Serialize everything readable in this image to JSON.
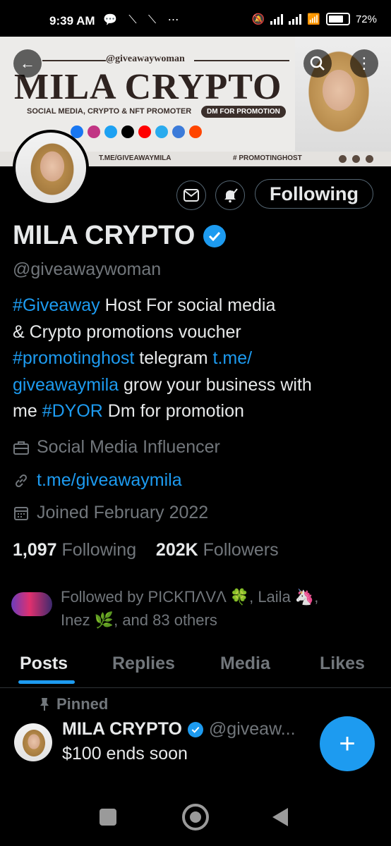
{
  "status_bar": {
    "time": "9:39 AM",
    "left_icons": "💬 ⟍ ⟍ ⋯",
    "battery": "72%"
  },
  "banner": {
    "handle": "@giveawaywoman",
    "title": "MILA CRYPTO",
    "subtitle": "SOCIAL MEDIA, CRYPTO & NFT PROMOTER",
    "dm_badge": "DM FOR PROMOTION",
    "telegram": "T.ME/GIVEAWAYMILA",
    "hashtag": "# PROMOTINGHOST",
    "social_colors": [
      "#1877f2",
      "#c13584",
      "#1da1f2",
      "#000000",
      "#ff0000",
      "#2aabee",
      "#3c7bd9",
      "#ff4500"
    ]
  },
  "header_buttons": {
    "back_icon": "←",
    "search_icon": "⌕",
    "more_icon": "⋮"
  },
  "profile": {
    "name": "MILA CRYPTO",
    "handle": "@giveawaywoman",
    "follow_label": "Following",
    "bio": {
      "tag1": "#Giveaway",
      "t1": " Host For social media",
      "t2": "& Crypto promotions voucher",
      "tag2": "#promotinghost",
      "t3": " telegram ",
      "link1": "t.me/",
      "link2": "giveawaymila",
      "t4": " grow your business with",
      "t5": "me ",
      "tag3": "#DYOR",
      "t6": " Dm for promotion"
    },
    "category": "Social Media Influencer",
    "website": "t.me/giveawaymila",
    "joined": "Joined February 2022",
    "following_count": "1,097",
    "following_label": "Following",
    "followers_count": "202K",
    "followers_label": "Followers",
    "followed_by_line1": "Followed by PICKΠΛVΛ 🍀, Laila 🦄,",
    "followed_by_line2": "Inez 🌿, and 83 others"
  },
  "tabs": [
    "Posts",
    "Replies",
    "Media",
    "Likes"
  ],
  "pinned_post": {
    "pinned_label": "Pinned",
    "author": "MILA CRYPTO",
    "handle": "@giveaw...",
    "text": "$100 ends soon"
  },
  "fab_label": "+",
  "colors": {
    "accent": "#1d9bf0",
    "secondary_text": "#71767b",
    "primary_text": "#e7e9ea",
    "background": "#000000"
  }
}
